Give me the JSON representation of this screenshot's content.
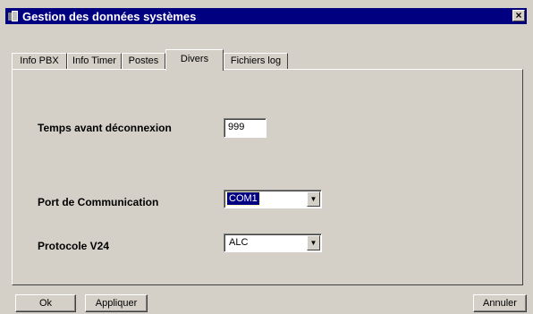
{
  "window": {
    "title": "Gestion des données systèmes",
    "close_symbol": "×"
  },
  "tabs": [
    {
      "label": "Info PBX"
    },
    {
      "label": "Info Timer"
    },
    {
      "label": "Postes"
    },
    {
      "label": "Divers"
    },
    {
      "label": "Fichiers log"
    }
  ],
  "active_tab": "Divers",
  "form": {
    "timeout_label": "Temps avant déconnexion",
    "timeout_value": "999",
    "port_label": "Port de Communication",
    "port_value": "COM1",
    "protocol_label": "Protocole V24",
    "protocol_value": "ALC"
  },
  "buttons": {
    "ok": "Ok",
    "apply": "Appliquer",
    "cancel": "Annuler"
  },
  "colors": {
    "titlebar": "#000080",
    "face": "#d4d0c8",
    "selection": "#000080"
  }
}
